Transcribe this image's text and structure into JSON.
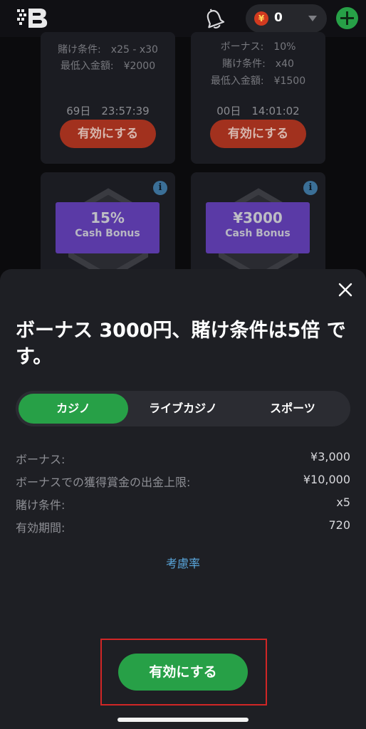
{
  "header": {
    "balance": "0",
    "coin_symbol": "¥"
  },
  "cards": [
    {
      "rows": [
        "賭け条件:　x25 - x30",
        "最低入金額:　¥2000"
      ],
      "timer": "69日　23:57:39",
      "button": "有効にする"
    },
    {
      "rows": [
        "ボーナス:　10%",
        "賭け条件:　x40",
        "最低入金額:　¥1500"
      ],
      "timer": "00日　14:01:02",
      "button": "有効にする"
    },
    {
      "promo_title": "15%",
      "promo_sub": "Cash Bonus",
      "info": "i"
    },
    {
      "promo_title": "¥3000",
      "promo_sub": "Cash Bonus",
      "info": "i"
    }
  ],
  "sheet": {
    "title": "ボーナス 3000円、賭け条件は5倍 です。",
    "tabs": [
      {
        "label": "カジノ",
        "active": true
      },
      {
        "label": "ライブカジノ",
        "active": false
      },
      {
        "label": "スポーツ",
        "active": false
      }
    ],
    "details": [
      {
        "label": "ボーナス:",
        "value": "¥3,000"
      },
      {
        "label": "ボーナスでの獲得賞金の出金上限:",
        "value": "¥10,000"
      },
      {
        "label": "賭け条件:",
        "value": "x5"
      },
      {
        "label": "有効期間:",
        "value": "720"
      }
    ],
    "rate_link": "考慮率",
    "activate_button": "有効にする"
  },
  "colors": {
    "accent_green": "#27a047",
    "card_button_red": "#a2311e",
    "promo_purple": "#5a3aa6",
    "link_blue": "#5aa7dd",
    "highlight_red": "#d12626"
  }
}
